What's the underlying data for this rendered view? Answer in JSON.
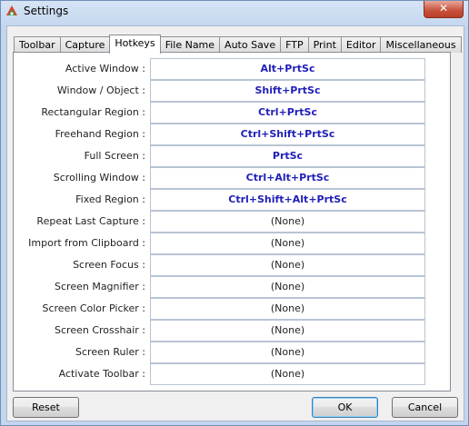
{
  "window": {
    "title": "Settings",
    "close_glyph": "✕"
  },
  "tabs": [
    {
      "label": "Toolbar"
    },
    {
      "label": "Capture"
    },
    {
      "label": "Hotkeys"
    },
    {
      "label": "File Name"
    },
    {
      "label": "Auto Save"
    },
    {
      "label": "FTP"
    },
    {
      "label": "Print"
    },
    {
      "label": "Editor"
    },
    {
      "label": "Miscellaneous"
    }
  ],
  "active_tab": "Hotkeys",
  "hotkeys": [
    {
      "label": "Active Window :",
      "value": "Alt+PrtSc",
      "set": true
    },
    {
      "label": "Window / Object :",
      "value": "Shift+PrtSc",
      "set": true
    },
    {
      "label": "Rectangular Region :",
      "value": "Ctrl+PrtSc",
      "set": true
    },
    {
      "label": "Freehand Region :",
      "value": "Ctrl+Shift+PrtSc",
      "set": true
    },
    {
      "label": "Full Screen :",
      "value": "PrtSc",
      "set": true
    },
    {
      "label": "Scrolling Window :",
      "value": "Ctrl+Alt+PrtSc",
      "set": true
    },
    {
      "label": "Fixed Region :",
      "value": "Ctrl+Shift+Alt+PrtSc",
      "set": true
    },
    {
      "label": "Repeat Last Capture :",
      "value": "(None)",
      "set": false
    },
    {
      "label": "Import from Clipboard :",
      "value": "(None)",
      "set": false
    },
    {
      "label": "Screen Focus :",
      "value": "(None)",
      "set": false
    },
    {
      "label": "Screen Magnifier :",
      "value": "(None)",
      "set": false
    },
    {
      "label": "Screen Color Picker :",
      "value": "(None)",
      "set": false
    },
    {
      "label": "Screen Crosshair :",
      "value": "(None)",
      "set": false
    },
    {
      "label": "Screen Ruler :",
      "value": "(None)",
      "set": false
    },
    {
      "label": "Activate Toolbar :",
      "value": "(None)",
      "set": false
    }
  ],
  "buttons": {
    "reset": "Reset",
    "ok": "OK",
    "cancel": "Cancel"
  },
  "colors": {
    "set_hotkey": "#2020b8",
    "none_hotkey": "#222222"
  }
}
